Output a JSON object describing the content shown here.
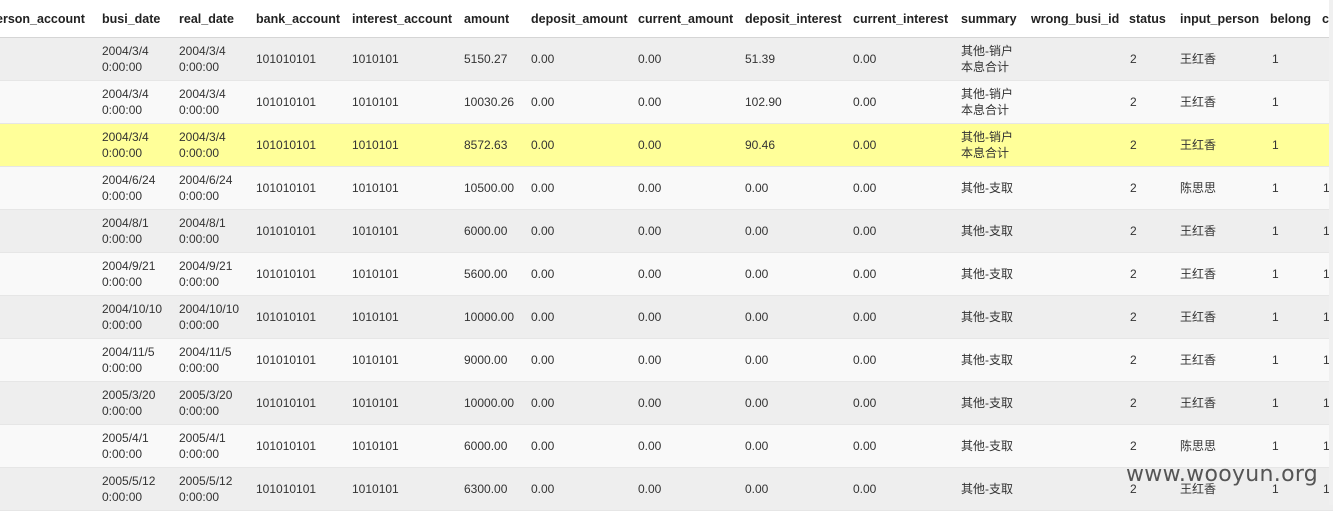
{
  "columns": {
    "person_account": "erson_account",
    "busi_date": "busi_date",
    "real_date": "real_date",
    "bank_account": "bank_account",
    "interest_account": "interest_account",
    "amount": "amount",
    "deposit_amount": "deposit_amount",
    "current_amount": "current_amount",
    "deposit_interest": "deposit_interest",
    "current_interest": "current_interest",
    "summary": "summary",
    "wrong_busi_id": "wrong_busi_id",
    "status": "status",
    "input_person": "input_person",
    "belong": "belong",
    "extra": "c"
  },
  "rows": [
    {
      "busi_date": [
        "2004/3/4",
        "0:00:00"
      ],
      "real_date": [
        "2004/3/4",
        "0:00:00"
      ],
      "bank_account": "101010101",
      "interest_account": "1010101",
      "amount": "5150.27",
      "deposit_amount": "0.00",
      "current_amount": "0.00",
      "deposit_interest": "51.39",
      "current_interest": "0.00",
      "summary": [
        "其他-销户",
        "本息合计"
      ],
      "wrong_busi_id": "",
      "status": "2",
      "input_person": "王红香",
      "belong": "1",
      "extra": ""
    },
    {
      "busi_date": [
        "2004/3/4",
        "0:00:00"
      ],
      "real_date": [
        "2004/3/4",
        "0:00:00"
      ],
      "bank_account": "101010101",
      "interest_account": "1010101",
      "amount": "10030.26",
      "deposit_amount": "0.00",
      "current_amount": "0.00",
      "deposit_interest": "102.90",
      "current_interest": "0.00",
      "summary": [
        "其他-销户",
        "本息合计"
      ],
      "wrong_busi_id": "",
      "status": "2",
      "input_person": "王红香",
      "belong": "1",
      "extra": ""
    },
    {
      "busi_date": [
        "2004/3/4",
        "0:00:00"
      ],
      "real_date": [
        "2004/3/4",
        "0:00:00"
      ],
      "bank_account": "101010101",
      "interest_account": "1010101",
      "amount": "8572.63",
      "deposit_amount": "0.00",
      "current_amount": "0.00",
      "deposit_interest": "90.46",
      "current_interest": "0.00",
      "summary": [
        "其他-销户",
        "本息合计"
      ],
      "wrong_busi_id": "",
      "status": "2",
      "input_person": "王红香",
      "belong": "1",
      "extra": "",
      "selected": true
    },
    {
      "busi_date": [
        "2004/6/24",
        "0:00:00"
      ],
      "real_date": [
        "2004/6/24",
        "0:00:00"
      ],
      "bank_account": "101010101",
      "interest_account": "1010101",
      "amount": "10500.00",
      "deposit_amount": "0.00",
      "current_amount": "0.00",
      "deposit_interest": "0.00",
      "current_interest": "0.00",
      "summary": [
        "其他-支取"
      ],
      "wrong_busi_id": "",
      "status": "2",
      "input_person": "陈思思",
      "belong": "1",
      "extra": "1"
    },
    {
      "busi_date": [
        "2004/8/1",
        "0:00:00"
      ],
      "real_date": [
        "2004/8/1",
        "0:00:00"
      ],
      "bank_account": "101010101",
      "interest_account": "1010101",
      "amount": "6000.00",
      "deposit_amount": "0.00",
      "current_amount": "0.00",
      "deposit_interest": "0.00",
      "current_interest": "0.00",
      "summary": [
        "其他-支取"
      ],
      "wrong_busi_id": "",
      "status": "2",
      "input_person": "王红香",
      "belong": "1",
      "extra": "1"
    },
    {
      "busi_date": [
        "2004/9/21",
        "0:00:00"
      ],
      "real_date": [
        "2004/9/21",
        "0:00:00"
      ],
      "bank_account": "101010101",
      "interest_account": "1010101",
      "amount": "5600.00",
      "deposit_amount": "0.00",
      "current_amount": "0.00",
      "deposit_interest": "0.00",
      "current_interest": "0.00",
      "summary": [
        "其他-支取"
      ],
      "wrong_busi_id": "",
      "status": "2",
      "input_person": "王红香",
      "belong": "1",
      "extra": "1"
    },
    {
      "busi_date": [
        "2004/10/10",
        "0:00:00"
      ],
      "real_date": [
        "2004/10/10",
        "0:00:00"
      ],
      "bank_account": "101010101",
      "interest_account": "1010101",
      "amount": "10000.00",
      "deposit_amount": "0.00",
      "current_amount": "0.00",
      "deposit_interest": "0.00",
      "current_interest": "0.00",
      "summary": [
        "其他-支取"
      ],
      "wrong_busi_id": "",
      "status": "2",
      "input_person": "王红香",
      "belong": "1",
      "extra": "1"
    },
    {
      "busi_date": [
        "2004/11/5",
        "0:00:00"
      ],
      "real_date": [
        "2004/11/5",
        "0:00:00"
      ],
      "bank_account": "101010101",
      "interest_account": "1010101",
      "amount": "9000.00",
      "deposit_amount": "0.00",
      "current_amount": "0.00",
      "deposit_interest": "0.00",
      "current_interest": "0.00",
      "summary": [
        "其他-支取"
      ],
      "wrong_busi_id": "",
      "status": "2",
      "input_person": "王红香",
      "belong": "1",
      "extra": "1"
    },
    {
      "busi_date": [
        "2005/3/20",
        "0:00:00"
      ],
      "real_date": [
        "2005/3/20",
        "0:00:00"
      ],
      "bank_account": "101010101",
      "interest_account": "1010101",
      "amount": "10000.00",
      "deposit_amount": "0.00",
      "current_amount": "0.00",
      "deposit_interest": "0.00",
      "current_interest": "0.00",
      "summary": [
        "其他-支取"
      ],
      "wrong_busi_id": "",
      "status": "2",
      "input_person": "王红香",
      "belong": "1",
      "extra": "1"
    },
    {
      "busi_date": [
        "2005/4/1",
        "0:00:00"
      ],
      "real_date": [
        "2005/4/1",
        "0:00:00"
      ],
      "bank_account": "101010101",
      "interest_account": "1010101",
      "amount": "6000.00",
      "deposit_amount": "0.00",
      "current_amount": "0.00",
      "deposit_interest": "0.00",
      "current_interest": "0.00",
      "summary": [
        "其他-支取"
      ],
      "wrong_busi_id": "",
      "status": "2",
      "input_person": "陈思思",
      "belong": "1",
      "extra": "1"
    },
    {
      "busi_date": [
        "2005/5/12",
        "0:00:00"
      ],
      "real_date": [
        "2005/5/12",
        "0:00:00"
      ],
      "bank_account": "101010101",
      "interest_account": "1010101",
      "amount": "6300.00",
      "deposit_amount": "0.00",
      "current_amount": "0.00",
      "deposit_interest": "0.00",
      "current_interest": "0.00",
      "summary": [
        "其他-支取"
      ],
      "wrong_busi_id": "",
      "status": "2",
      "input_person": "王红香",
      "belong": "1",
      "extra": "1"
    }
  ],
  "watermark": "www.wooyun.org",
  "colors": {
    "row_odd": "#eeeeee",
    "row_even": "#f9f9f9",
    "row_selected": "#ffff99"
  }
}
